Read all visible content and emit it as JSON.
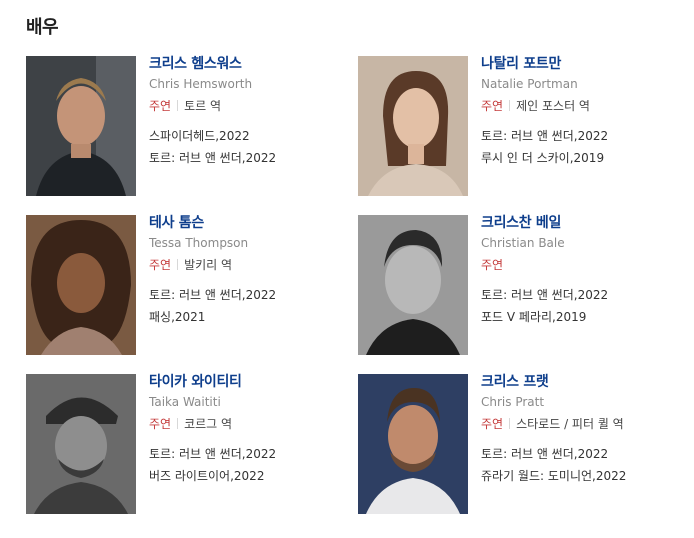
{
  "section_title": "배우",
  "actors": [
    {
      "name_ko": "크리스 헴스워스",
      "name_en": "Chris Hemsworth",
      "role_type": "주연",
      "role_name": "토르 역",
      "works": [
        "스파이더헤드,2022",
        "토르: 러브 앤 썬더,2022"
      ]
    },
    {
      "name_ko": "나탈리 포트만",
      "name_en": "Natalie Portman",
      "role_type": "주연",
      "role_name": "제인 포스터 역",
      "works": [
        "토르: 러브 앤 썬더,2022",
        "루시 인 더 스카이,2019"
      ]
    },
    {
      "name_ko": "테사 톰슨",
      "name_en": "Tessa Thompson",
      "role_type": "주연",
      "role_name": "발키리 역",
      "works": [
        "토르: 러브 앤 썬더,2022",
        "패싱,2021"
      ]
    },
    {
      "name_ko": "크리스찬 베일",
      "name_en": "Christian Bale",
      "role_type": "주연",
      "role_name": "",
      "works": [
        "토르: 러브 앤 썬더,2022",
        "포드 V 페라리,2019"
      ]
    },
    {
      "name_ko": "타이카 와이티티",
      "name_en": "Taika Waititi",
      "role_type": "주연",
      "role_name": "코르그 역",
      "works": [
        "토르: 러브 앤 썬더,2022",
        "버즈 라이트이어,2022"
      ]
    },
    {
      "name_ko": "크리스 프랫",
      "name_en": "Chris Pratt",
      "role_type": "주연",
      "role_name": "스타로드 / 피터 퀼 역",
      "works": [
        "토르: 러브 앤 썬더,2022",
        "쥬라기 월드: 도미니언,2022"
      ]
    }
  ],
  "photo_colors": [
    "#4a4a4a",
    "#c9b7a6",
    "#6e4a35",
    "#8c8c8c",
    "#5a5a5a",
    "#2e3f63"
  ]
}
